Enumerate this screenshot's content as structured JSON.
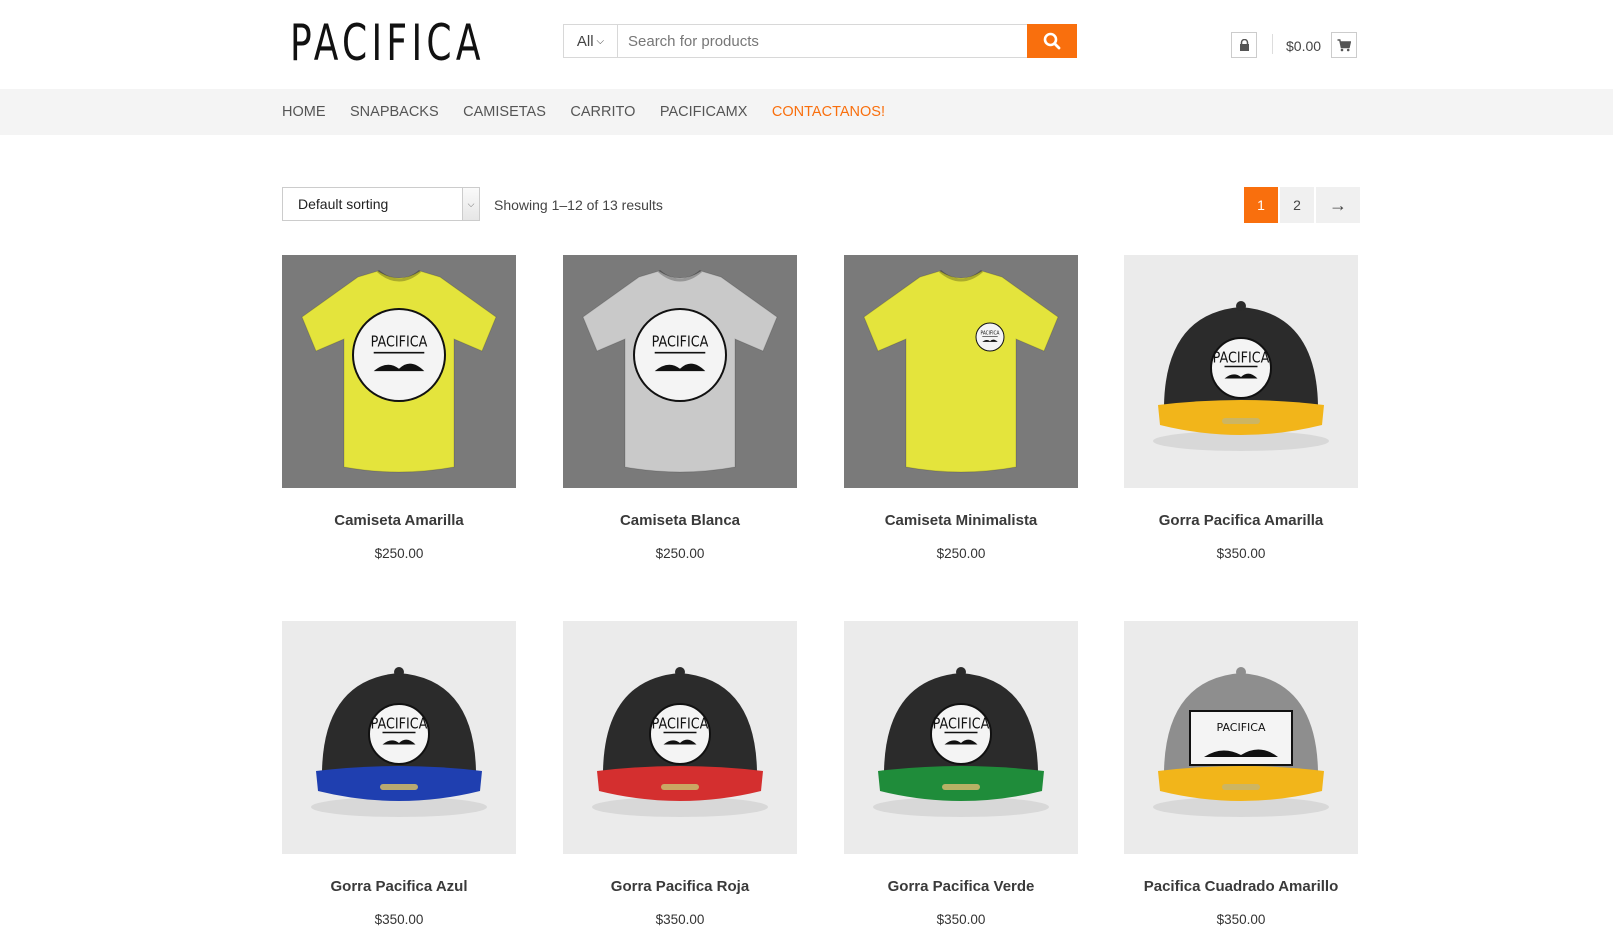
{
  "brand": {
    "logo_text": "PACIFICA",
    "accent": "#f96f0d"
  },
  "search": {
    "category": "All",
    "placeholder": "Search for products",
    "button_icon": "search-icon"
  },
  "account": {
    "icon": "lock-icon"
  },
  "cart": {
    "total": "$0.00",
    "icon": "cart-icon"
  },
  "nav": {
    "items": [
      {
        "label": "HOME"
      },
      {
        "label": "SNAPBACKS"
      },
      {
        "label": "CAMISETAS"
      },
      {
        "label": "CARRITO"
      },
      {
        "label": "PACIFICAMX"
      },
      {
        "label": "CONTACTANOS!",
        "active": true
      }
    ]
  },
  "toolbar": {
    "sorting": "Default sorting",
    "result_count": "Showing 1–12 of 13 results",
    "pages": [
      "1",
      "2"
    ],
    "current_page": "1",
    "next": "→"
  },
  "products": [
    {
      "name": "Camiseta Amarilla",
      "price": "$250.00",
      "kind": "shirt",
      "color": "#e4e43c",
      "bg": "dark",
      "print": "big"
    },
    {
      "name": "Camiseta Blanca",
      "price": "$250.00",
      "kind": "shirt",
      "color": "#c9c9c9",
      "bg": "dark",
      "print": "big"
    },
    {
      "name": "Camiseta Minimalista",
      "price": "$250.00",
      "kind": "shirt",
      "color": "#e4e43c",
      "bg": "dark",
      "print": "small"
    },
    {
      "name": "Gorra Pacifica Amarilla",
      "price": "$350.00",
      "kind": "cap",
      "color": "#2b2b2b",
      "brim": "#f2b51a",
      "bg": "light",
      "patch": "round"
    },
    {
      "name": "Gorra Pacifica Azul",
      "price": "$350.00",
      "kind": "cap",
      "color": "#2b2b2b",
      "brim": "#1f3fb0",
      "bg": "light",
      "patch": "round"
    },
    {
      "name": "Gorra Pacifica Roja",
      "price": "$350.00",
      "kind": "cap",
      "color": "#2b2b2b",
      "brim": "#d42f2f",
      "bg": "light",
      "patch": "round"
    },
    {
      "name": "Gorra Pacifica Verde",
      "price": "$350.00",
      "kind": "cap",
      "color": "#2b2b2b",
      "brim": "#1f8c3a",
      "bg": "light",
      "patch": "round"
    },
    {
      "name": "Pacifica Cuadrado Amarillo",
      "price": "$350.00",
      "kind": "cap",
      "color": "#8e8e8e",
      "brim": "#f2b51a",
      "bg": "light",
      "patch": "square"
    }
  ]
}
